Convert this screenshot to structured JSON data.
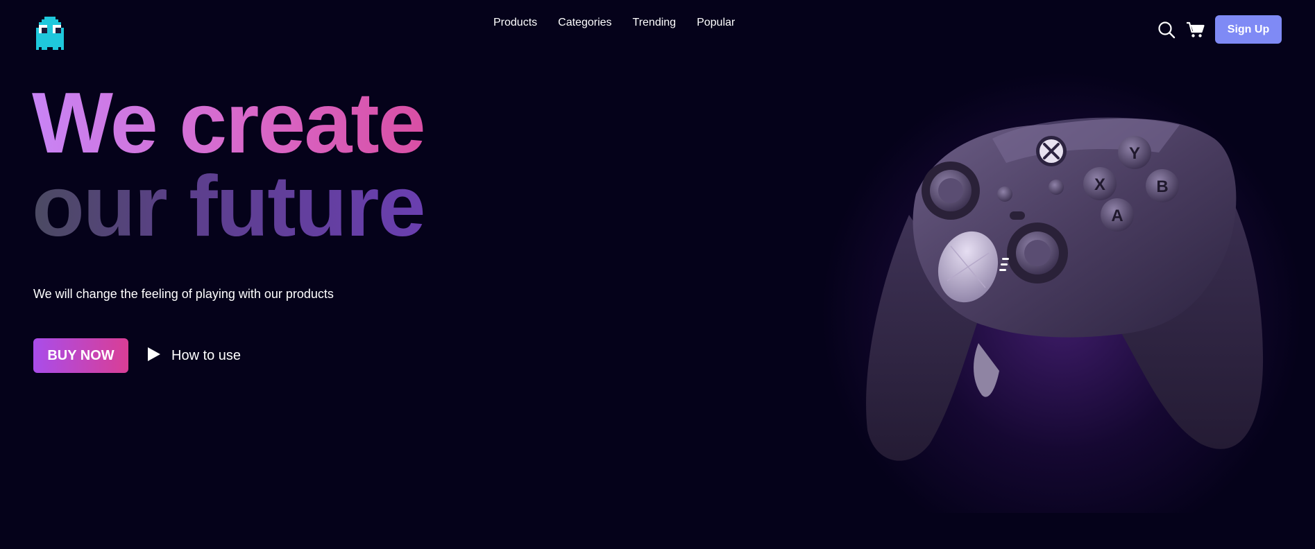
{
  "header": {
    "logo_icon": "pixel-ghost-logo-icon",
    "nav": [
      {
        "label": "Products"
      },
      {
        "label": "Categories"
      },
      {
        "label": "Trending"
      },
      {
        "label": "Popular"
      }
    ],
    "search_icon": "search-icon",
    "cart_icon": "cart-icon",
    "signup_label": "Sign Up"
  },
  "hero": {
    "headline_line1": "We create",
    "headline_line2": "our future",
    "subtitle": "We will change the feeling of playing with our products",
    "buy_label": "BUY NOW",
    "how_label": "How to use",
    "play_icon": "play-icon",
    "product_image": "game-controller-image"
  },
  "colors": {
    "background": "#05021a",
    "accent": "#7f8af5",
    "buy_gradient_start": "#a94dea",
    "buy_gradient_end": "#d93e95",
    "logo_cyan": "#1fc8dc"
  }
}
